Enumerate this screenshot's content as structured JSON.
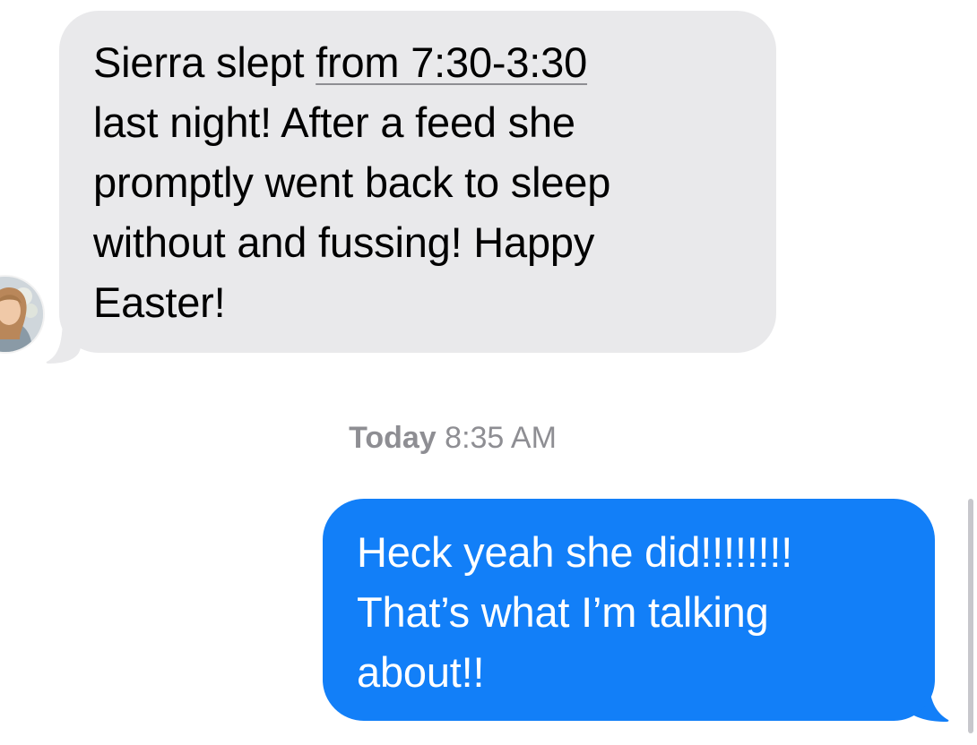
{
  "incoming": {
    "lines": [
      {
        "before": "Sierra slept ",
        "link": "from 7:30-3:30"
      },
      "last night! After a feed she",
      "promptly went back to sleep",
      "without and fussing! Happy",
      "Easter!"
    ],
    "bubble_color": "#e9e9eb",
    "text_color": "#000000",
    "avatar_icon": "contact-avatar-photo"
  },
  "timestamp": {
    "day": "Today",
    "time": "8:35 AM"
  },
  "outgoing": {
    "lines": [
      "Heck yeah she did!!!!!!!!",
      "That’s what I’m talking",
      "about!!"
    ],
    "bubble_color": "#127ff8",
    "text_color": "#ffffff"
  }
}
